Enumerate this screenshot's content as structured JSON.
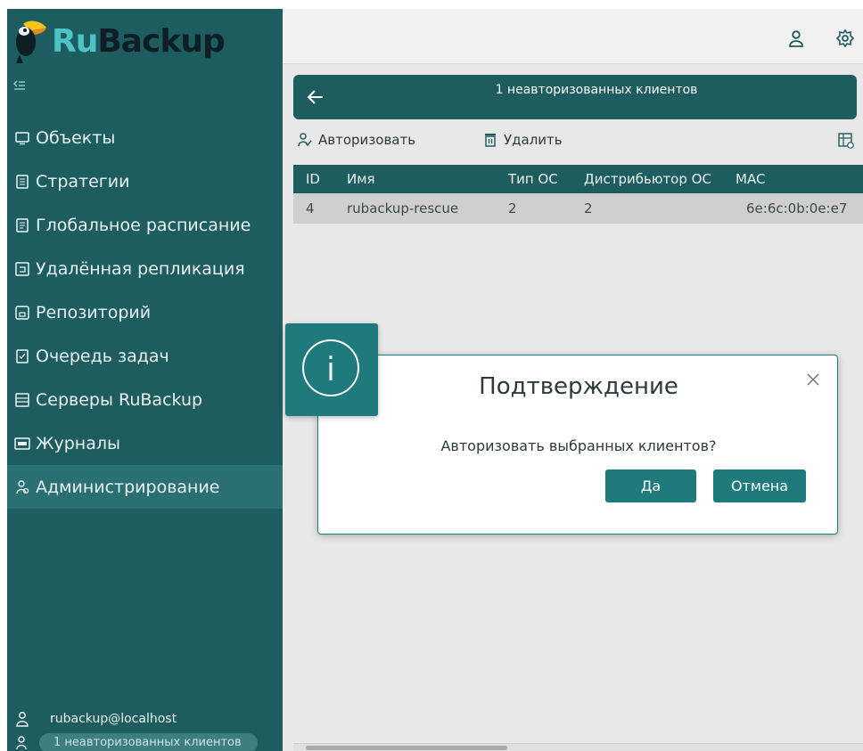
{
  "app": {
    "logo_prefix": "Ru",
    "logo_suffix": "Backup"
  },
  "sidebar": {
    "items": [
      {
        "label": "Объекты",
        "icon": "monitor-icon"
      },
      {
        "label": "Стратегии",
        "icon": "document-icon"
      },
      {
        "label": "Глобальное расписание",
        "icon": "schedule-icon"
      },
      {
        "label": "Удалённая репликация",
        "icon": "replication-icon"
      },
      {
        "label": "Репозиторий",
        "icon": "repository-icon"
      },
      {
        "label": "Очередь задач",
        "icon": "task-queue-icon"
      },
      {
        "label": "Серверы RuBackup",
        "icon": "server-icon"
      },
      {
        "label": "Журналы",
        "icon": "log-icon"
      },
      {
        "label": "Администрирование",
        "icon": "admin-icon",
        "active": true
      }
    ],
    "user": "rubackup@localhost",
    "unauthorized_badge": "1 неавторизованных клиентов"
  },
  "main": {
    "header_title": "1 неавторизованных клиентов",
    "toolbar": {
      "authorize_label": "Авторизовать",
      "delete_label": "Удалить"
    },
    "table": {
      "columns": [
        "ID",
        "Имя",
        "Тип ОС",
        "Дистрибьютор ОС",
        "MAC"
      ],
      "rows": [
        [
          "4",
          "rubackup-rescue",
          "2",
          "2",
          "6e:6c:0b:0e:e7"
        ]
      ]
    }
  },
  "modal": {
    "title": "Подтверждение",
    "message": "Авторизовать выбранных клиентов?",
    "yes_label": "Да",
    "cancel_label": "Отмена"
  },
  "colors": {
    "sidebar_bg": "#1e5d5f",
    "accent": "#1e7a7c",
    "logo_ru": "#4ec3c8"
  }
}
